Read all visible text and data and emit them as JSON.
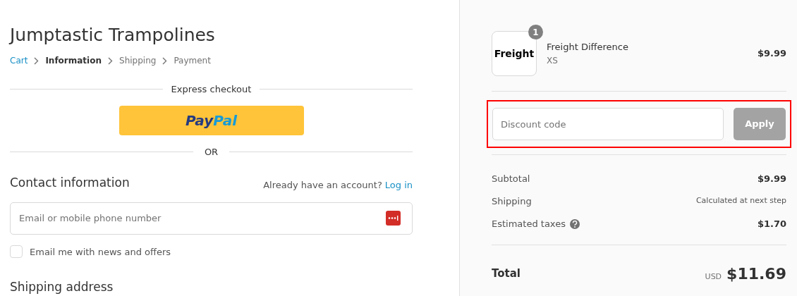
{
  "store": {
    "title": "Jumptastic Trampolines"
  },
  "breadcrumbs": [
    {
      "label": "Cart",
      "kind": "link"
    },
    {
      "label": "Information",
      "kind": "current"
    },
    {
      "label": "Shipping",
      "kind": "upcoming"
    },
    {
      "label": "Payment",
      "kind": "upcoming"
    }
  ],
  "express_checkout": {
    "title": "Express checkout",
    "button": "Pay",
    "button_accent": "Pal"
  },
  "divider_text": "OR",
  "contact": {
    "title": "Contact information",
    "account_prompt": "Already have an account?",
    "login_link": "Log in",
    "email_field": {
      "placeholder": "Email or mobile phone number"
    },
    "newsletter": {
      "label": "Email me with news and offers",
      "checked": false
    }
  },
  "next_section": {
    "title": "Shipping address"
  },
  "order_summary": {
    "items": [
      {
        "image_text": "Freight",
        "quantity": "1",
        "name": "Freight Difference",
        "variant": "XS",
        "price": "$9.99"
      }
    ],
    "discount": {
      "placeholder": "Discount code",
      "button": "Apply",
      "disabled": true,
      "highlighted": true
    },
    "lines": [
      {
        "label": "Subtotal",
        "value": "$9.99",
        "kind": "amount",
        "info": false
      },
      {
        "label": "Shipping",
        "value": "Calculated at next step",
        "kind": "note",
        "info": false
      },
      {
        "label": "Estimated taxes",
        "value": "$1.70",
        "kind": "amount",
        "info": true
      }
    ],
    "total": {
      "label": "Total",
      "currency": "USD",
      "amount": "$11.69"
    }
  }
}
